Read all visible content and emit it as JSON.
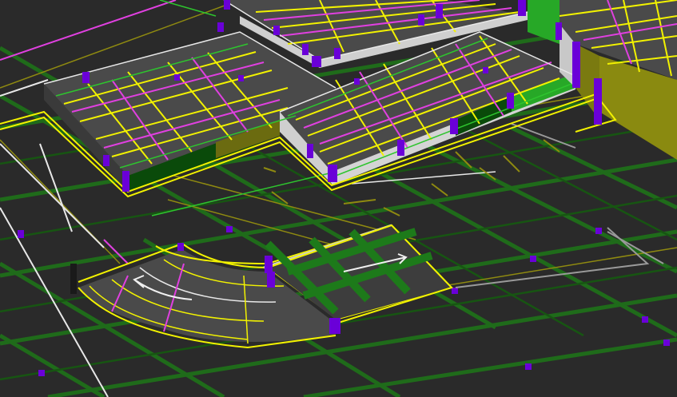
{
  "scene": {
    "kind": "3D CAD/BIM viewport - structural framing and ramp",
    "colors": {
      "background": "#2a2a2a",
      "floor_grid": "#1f6b1a",
      "beam_yellow": "#f2f200",
      "beam_magenta": "#e040e0",
      "outline_white": "#e8e8e8",
      "olive_line": "#8f8a10",
      "slab_edge": "#c8c8c8",
      "slab_top": "#4a4a4a",
      "green_wall": "#27a827",
      "dark_green_wall": "#0a4a0a",
      "column_purple": "#6a00d8",
      "olive_wall": "#7a7a10"
    },
    "icons": [
      "direction-arrow-icon",
      "direction-arrow-icon"
    ]
  }
}
